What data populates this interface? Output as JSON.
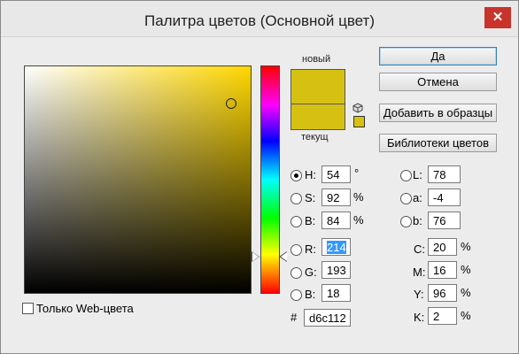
{
  "window": {
    "title": "Палитра цветов (Основной цвет)",
    "close_glyph": "✕"
  },
  "colors": {
    "new": "#d6c112",
    "current": "#d6c112",
    "accent_selection": "#3399ff",
    "close_button": "#c8332b"
  },
  "preview": {
    "new_label": "новый",
    "current_label": "текущ"
  },
  "buttons": {
    "ok": "Да",
    "cancel": "Отмена",
    "add_to_swatches": "Добавить в образцы",
    "color_libraries": "Библиотеки цветов"
  },
  "hsb": {
    "h": {
      "label": "H:",
      "value": "54",
      "unit": "°",
      "selected": true
    },
    "s": {
      "label": "S:",
      "value": "92",
      "unit": "%"
    },
    "b": {
      "label": "B:",
      "value": "84",
      "unit": "%"
    }
  },
  "rgb": {
    "r": {
      "label": "R:",
      "value": "214"
    },
    "g": {
      "label": "G:",
      "value": "193"
    },
    "b": {
      "label": "B:",
      "value": "18"
    }
  },
  "lab": {
    "l": {
      "label": "L:",
      "value": "78"
    },
    "a": {
      "label": "a:",
      "value": "-4"
    },
    "b": {
      "label": "b:",
      "value": "76"
    }
  },
  "cmyk": {
    "c": {
      "label": "C:",
      "value": "20",
      "unit": "%"
    },
    "m": {
      "label": "M:",
      "value": "16",
      "unit": "%"
    },
    "y": {
      "label": "Y:",
      "value": "96",
      "unit": "%"
    },
    "k": {
      "label": "K:",
      "value": "2",
      "unit": "%"
    }
  },
  "hex": {
    "label": "#",
    "value": "d6c112"
  },
  "web_only": {
    "label": "Только Web-цвета",
    "checked": false
  }
}
